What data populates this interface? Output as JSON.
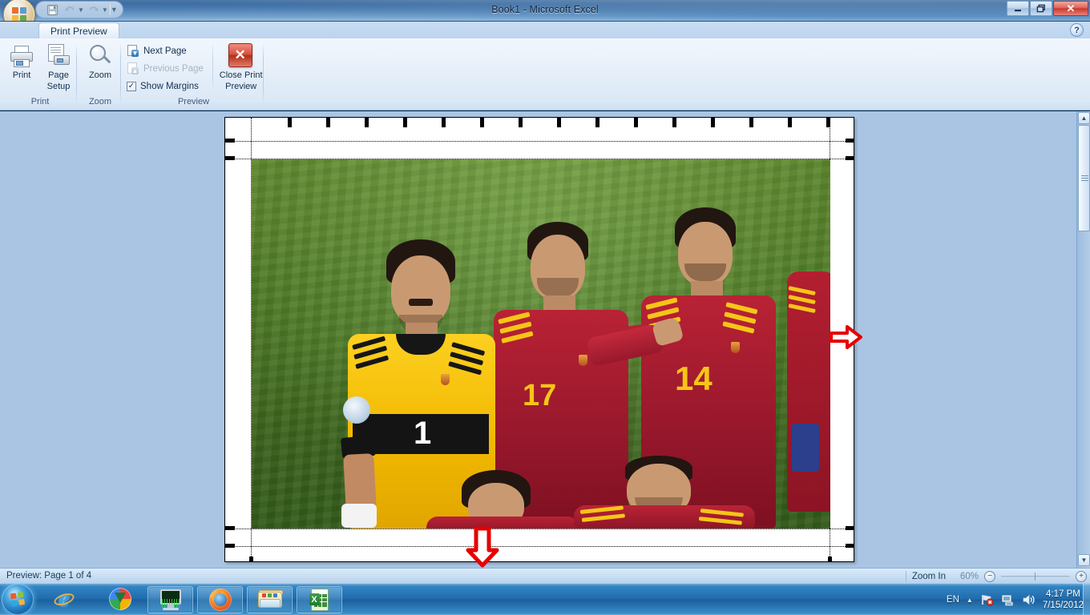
{
  "window": {
    "title": "Book1 - Microsoft Excel",
    "minimize_label": "—",
    "restore_label": "❐",
    "close_label": "✕",
    "help_label": "?"
  },
  "quick_access": {
    "save_label": "Save",
    "undo_label": "Undo",
    "redo_label": "Redo",
    "customize_label": "Customize Quick Access Toolbar",
    "caret": "▼"
  },
  "ribbon": {
    "tab_label": "Print Preview",
    "groups": [
      {
        "name": "Print",
        "label": "Print",
        "buttons": [
          {
            "label": "Print",
            "icon": "printer-icon"
          },
          {
            "label": "Page\nSetup",
            "label_line1": "Page",
            "label_line2": "Setup",
            "icon": "page-setup-icon"
          }
        ]
      },
      {
        "name": "Zoom",
        "label": "Zoom",
        "buttons": [
          {
            "label": "Zoom",
            "icon": "magnifier-icon"
          }
        ]
      },
      {
        "name": "Preview",
        "label": "Preview",
        "items": [
          {
            "label": "Next Page",
            "icon": "next-page-icon",
            "enabled": true
          },
          {
            "label": "Previous Page",
            "icon": "previous-page-icon",
            "enabled": false
          },
          {
            "label": "Show Margins",
            "icon": "checkbox-checked",
            "checked": true,
            "check_glyph": "✓"
          }
        ],
        "close_button": {
          "label_line1": "Close Print",
          "label_line2": "Preview",
          "icon": "close-preview-icon",
          "glyph": "✕"
        }
      }
    ]
  },
  "preview": {
    "page_number_text": "Preview: Page 1 of 4",
    "photo": {
      "alt": "Spain national football team players lined up on pitch",
      "jersey_numbers": [
        "1",
        "17",
        "14"
      ],
      "goalkeeper_color": "#f2c200",
      "outfield_color": "#a6192e",
      "pitch_color": "#5a8c2b"
    },
    "annotations": [
      {
        "name": "right-margin-arrow",
        "direction": "right",
        "color": "#e60000"
      },
      {
        "name": "bottom-margin-arrow",
        "direction": "down",
        "color": "#e60000"
      }
    ]
  },
  "scrollbar": {
    "up_arrow": "▲",
    "down_arrow": "▼"
  },
  "status_bar": {
    "text": "Preview: Page 1 of 4",
    "zoom_label": "Zoom In",
    "zoom_percent": "60%",
    "zoom_out_glyph": "−",
    "zoom_in_glyph": "+"
  },
  "taskbar": {
    "start_label": "Start",
    "quick_launch": [
      {
        "name": "internet-explorer-icon",
        "label": "Internet Explorer",
        "glyph": "e"
      },
      {
        "name": "idm-icon",
        "label": "Internet Download Manager"
      }
    ],
    "tasks": [
      {
        "name": "system-monitor-icon",
        "label": "System Monitor"
      },
      {
        "name": "firefox-icon",
        "label": "Mozilla Firefox"
      },
      {
        "name": "explorer-icon",
        "label": "Windows Explorer"
      },
      {
        "name": "excel-icon",
        "label": "Microsoft Excel",
        "glyph": "X"
      }
    ],
    "tray": {
      "language": "EN",
      "show_hidden_glyph": "▲",
      "icons": [
        {
          "name": "action-center-icon",
          "label": "Action Center"
        },
        {
          "name": "network-icon",
          "label": "Network"
        },
        {
          "name": "volume-icon",
          "label": "Volume"
        }
      ],
      "time": "4:17 PM",
      "date": "7/15/2012"
    }
  },
  "colors": {
    "accent": "#2f6fb0",
    "workspace": "#a9c5e3",
    "annotation_red": "#e60000",
    "taskbar_blue": "#1c609e"
  }
}
